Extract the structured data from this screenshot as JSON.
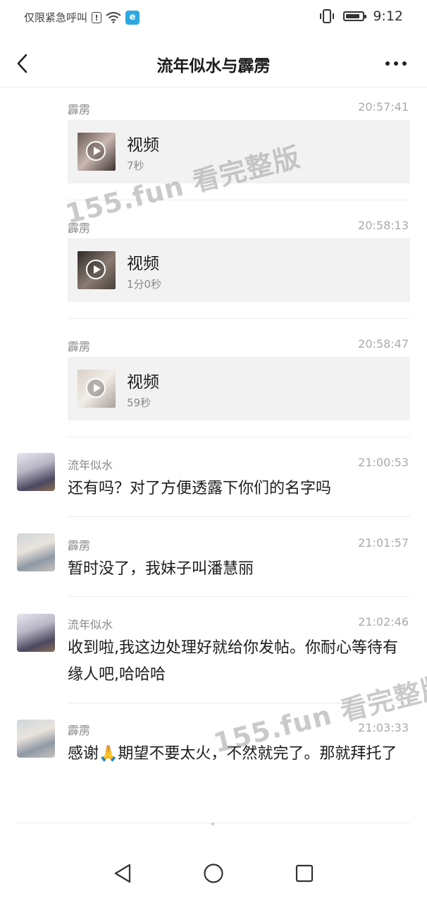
{
  "status_bar": {
    "carrier": "仅限紧急呼叫",
    "time": "9:12",
    "icons": [
      "alert-icon",
      "wifi-icon",
      "app-icon",
      "vibrate-icon",
      "battery-icon"
    ]
  },
  "header": {
    "title": "流年似水与霹雳",
    "back_icon": "chevron-left-icon",
    "more_icon": "more-dots-icon"
  },
  "watermark": "155.fun 看完整版",
  "videos": [
    {
      "sender": "霹雳",
      "time": "20:57:41",
      "title": "视频",
      "duration": "7秒"
    },
    {
      "sender": "霹雳",
      "time": "20:58:13",
      "title": "视频",
      "duration": "1分0秒"
    },
    {
      "sender": "霹雳",
      "time": "20:58:47",
      "title": "视频",
      "duration": "59秒"
    }
  ],
  "messages": [
    {
      "sender": "流年似水",
      "time": "21:00:53",
      "text": "还有吗？对了方便透露下你们的名字吗"
    },
    {
      "sender": "霹雳",
      "time": "21:01:57",
      "text": "暂时没了，我妹子叫潘慧丽"
    },
    {
      "sender": "流年似水",
      "time": "21:02:46",
      "text": "收到啦,我这边处理好就给你发帖。你耐心等待有缘人吧,哈哈哈"
    },
    {
      "sender": "霹雳",
      "time": "21:03:33",
      "text": "感谢🙏期望不要太火，不然就完了。那就拜托了"
    }
  ],
  "nav_bar": {
    "icons": [
      "back-triangle-icon",
      "home-circle-icon",
      "recents-square-icon"
    ]
  }
}
